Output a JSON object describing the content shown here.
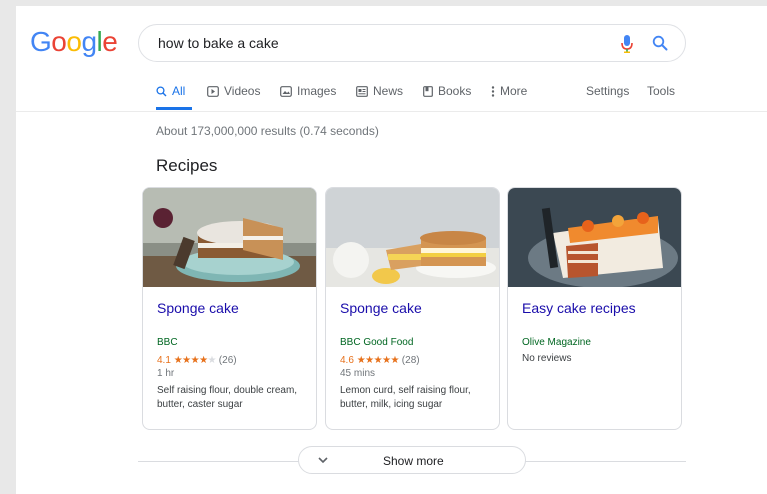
{
  "logo": {
    "letters": [
      "G",
      "o",
      "o",
      "g",
      "l",
      "e"
    ],
    "colors": [
      "#4285F4",
      "#EA4335",
      "#FBBC05",
      "#4285F4",
      "#34A853",
      "#EA4335"
    ]
  },
  "search": {
    "query": "how to bake a cake"
  },
  "tabs": [
    {
      "label": "All",
      "icon": "search-icon",
      "active": true
    },
    {
      "label": "Videos",
      "icon": "video-icon"
    },
    {
      "label": "Images",
      "icon": "image-icon"
    },
    {
      "label": "News",
      "icon": "news-icon"
    },
    {
      "label": "Books",
      "icon": "book-icon"
    },
    {
      "label": "More",
      "icon": "more-vert-icon"
    }
  ],
  "tools": {
    "settings": "Settings",
    "tools": "Tools"
  },
  "stats": "About 173,000,000 results (0.74 seconds)",
  "recipes": {
    "title": "Recipes",
    "cards": [
      {
        "title": "Sponge cake",
        "source": "BBC",
        "rating": "4.1",
        "stars": "★★★★",
        "dim_stars": "★",
        "reviews": "(26)",
        "time": "1 hr",
        "ingredients": "Self raising flour, double cream, butter, caster sugar"
      },
      {
        "title": "Sponge cake",
        "source": "BBC Good Food",
        "rating": "4.6",
        "stars": "★★★★★",
        "dim_stars": "",
        "reviews": "(28)",
        "time": "45 mins",
        "ingredients": "Lemon curd, self raising flour, butter, milk, icing sugar"
      },
      {
        "title": "Easy cake recipes",
        "source": "Olive Magazine",
        "no_reviews": "No reviews"
      }
    ]
  },
  "show_more": "Show more",
  "colors": {
    "link": "#1a0dab",
    "source": "#006621",
    "accent": "#1a73e8",
    "rating": "#e7711b"
  }
}
